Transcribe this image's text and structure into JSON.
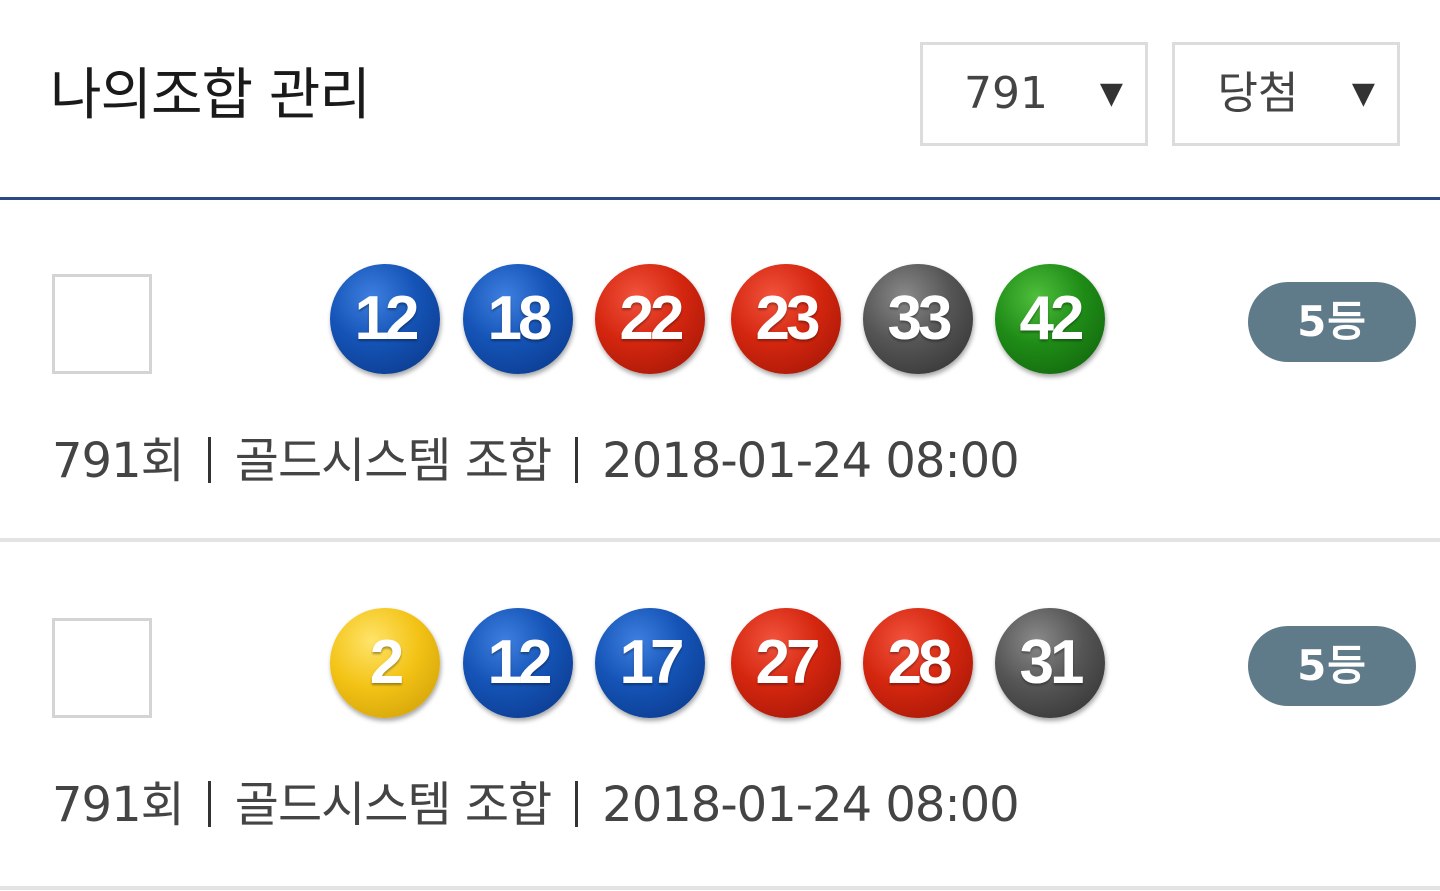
{
  "header": {
    "title": "나의조합 관리",
    "round_select": {
      "value": "791",
      "arrow": "▼"
    },
    "filter_select": {
      "value": "당첨",
      "arrow": "▼"
    }
  },
  "colors": {
    "header_border": "#2b4a84",
    "badge_bg": "#5f7b8a",
    "ball_yellow": "#f3c316",
    "ball_blue": "#1453b5",
    "ball_red": "#d4260f",
    "ball_gray": "#555555",
    "ball_green": "#1f8c17"
  },
  "combinations": [
    {
      "checked": false,
      "numbers": [
        {
          "value": "12",
          "color": "blue"
        },
        {
          "value": "18",
          "color": "blue"
        },
        {
          "value": "22",
          "color": "red"
        },
        {
          "value": "23",
          "color": "red"
        },
        {
          "value": "33",
          "color": "gray"
        },
        {
          "value": "42",
          "color": "green"
        }
      ],
      "rank_badge": "5등",
      "round": "791회",
      "type": "골드시스템 조합",
      "datetime": "2018-01-24 08:00"
    },
    {
      "checked": false,
      "numbers": [
        {
          "value": "2",
          "color": "yellow"
        },
        {
          "value": "12",
          "color": "blue"
        },
        {
          "value": "17",
          "color": "blue"
        },
        {
          "value": "27",
          "color": "red"
        },
        {
          "value": "28",
          "color": "red"
        },
        {
          "value": "31",
          "color": "gray"
        }
      ],
      "rank_badge": "5등",
      "round": "791회",
      "type": "골드시스템 조합",
      "datetime": "2018-01-24 08:00"
    }
  ]
}
